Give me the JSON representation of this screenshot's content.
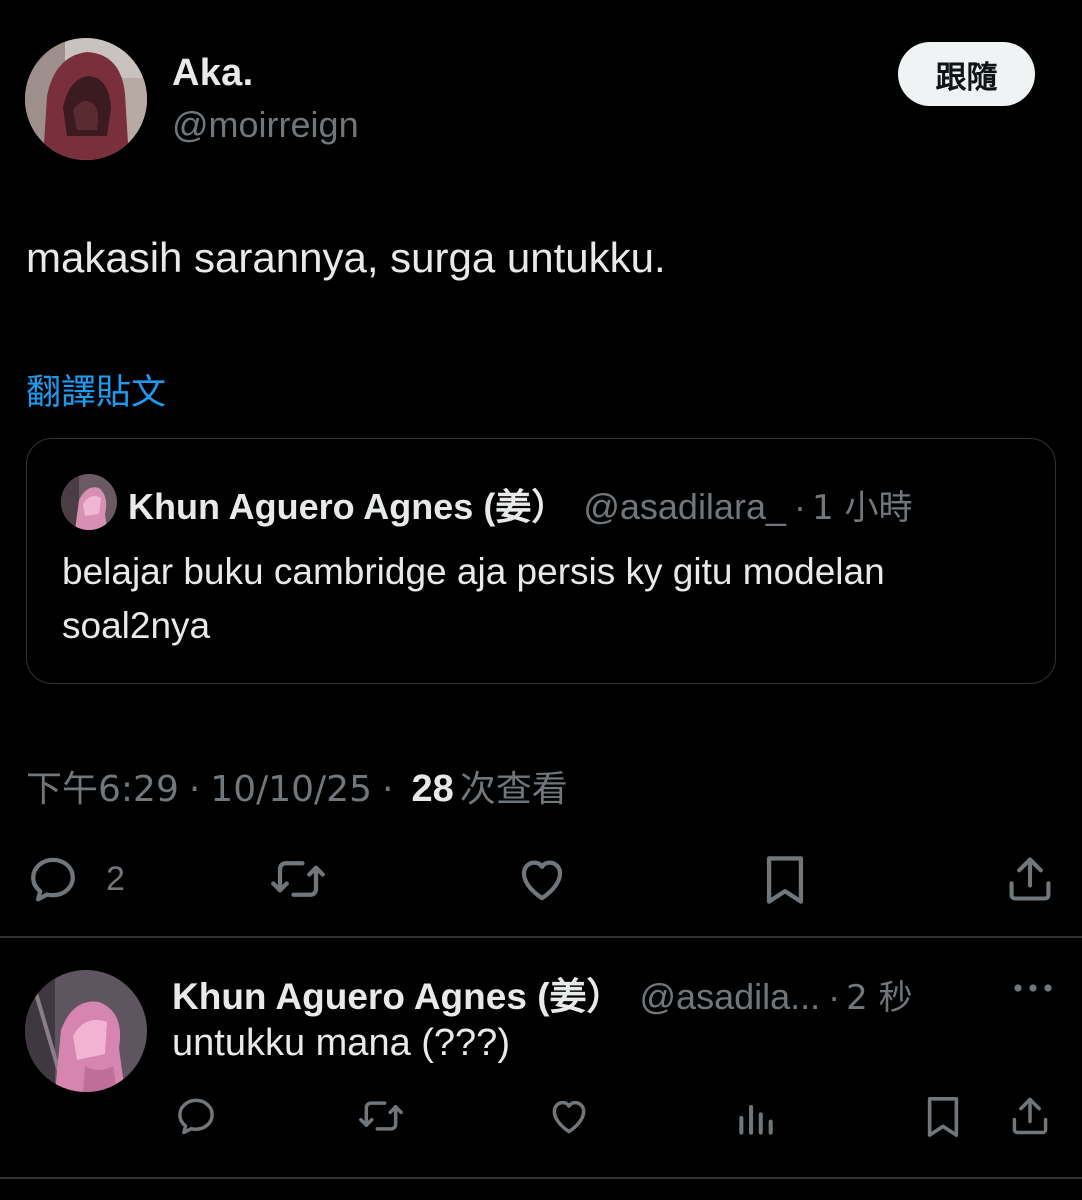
{
  "author": {
    "display_name": "Aka.",
    "handle": "@moirreign",
    "follow_label": "跟隨"
  },
  "post": {
    "text": "makasih sarannya, surga untukku.",
    "translate_label": "翻譯貼文"
  },
  "quoted": {
    "display_name": "Khun Aguero Agnes (姜）",
    "handle": "@asadilara_",
    "dot": "·",
    "time": "1 小時",
    "text": "belajar buku cambridge aja persis ky gitu modelan soal2nya"
  },
  "meta": {
    "time": "下午6:29",
    "separator": "·",
    "date": "10/10/25",
    "views_count": "28",
    "views_label": "次查看"
  },
  "actions": {
    "reply_count": "2"
  },
  "reply": {
    "display_name": "Khun Aguero Agnes (姜）",
    "handle": "@asadila...",
    "dot": "·",
    "time": "2 秒",
    "text": "untukku mana (???)"
  },
  "colors": {
    "background": "#000000",
    "text_primary": "#e7e9ea",
    "text_secondary": "#71767b",
    "link": "#1d9bf0",
    "border": "#2f3336",
    "follow_bg": "#eff3f4"
  }
}
